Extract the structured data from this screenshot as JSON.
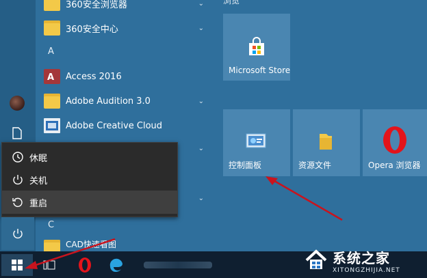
{
  "app_list": {
    "rows": [
      {
        "label": "360安全浏览器"
      },
      {
        "label": "360安全中心"
      },
      {
        "label": "Access 2016"
      },
      {
        "label": "Adobe Audition 3.0"
      },
      {
        "label": "Adobe Creative Cloud"
      },
      {
        "label": "CAD快速看图"
      }
    ],
    "letters": [
      "A",
      "C"
    ]
  },
  "power_menu": {
    "items": [
      {
        "label": "休眠"
      },
      {
        "label": "关机"
      },
      {
        "label": "重启"
      }
    ]
  },
  "tiles": {
    "group_header": "浏览",
    "items": [
      {
        "label": "Microsoft Store"
      },
      {
        "label": "控制面板"
      },
      {
        "label": "资源文件"
      },
      {
        "label": "Opera 浏览器"
      }
    ]
  },
  "watermark": {
    "cn": "系统之家",
    "en": "XITONGZHIJIA.NET"
  },
  "colors": {
    "accent_arrow": "#c8141e",
    "folder": "#f3c948",
    "start_bg": "#2f6f9c"
  }
}
